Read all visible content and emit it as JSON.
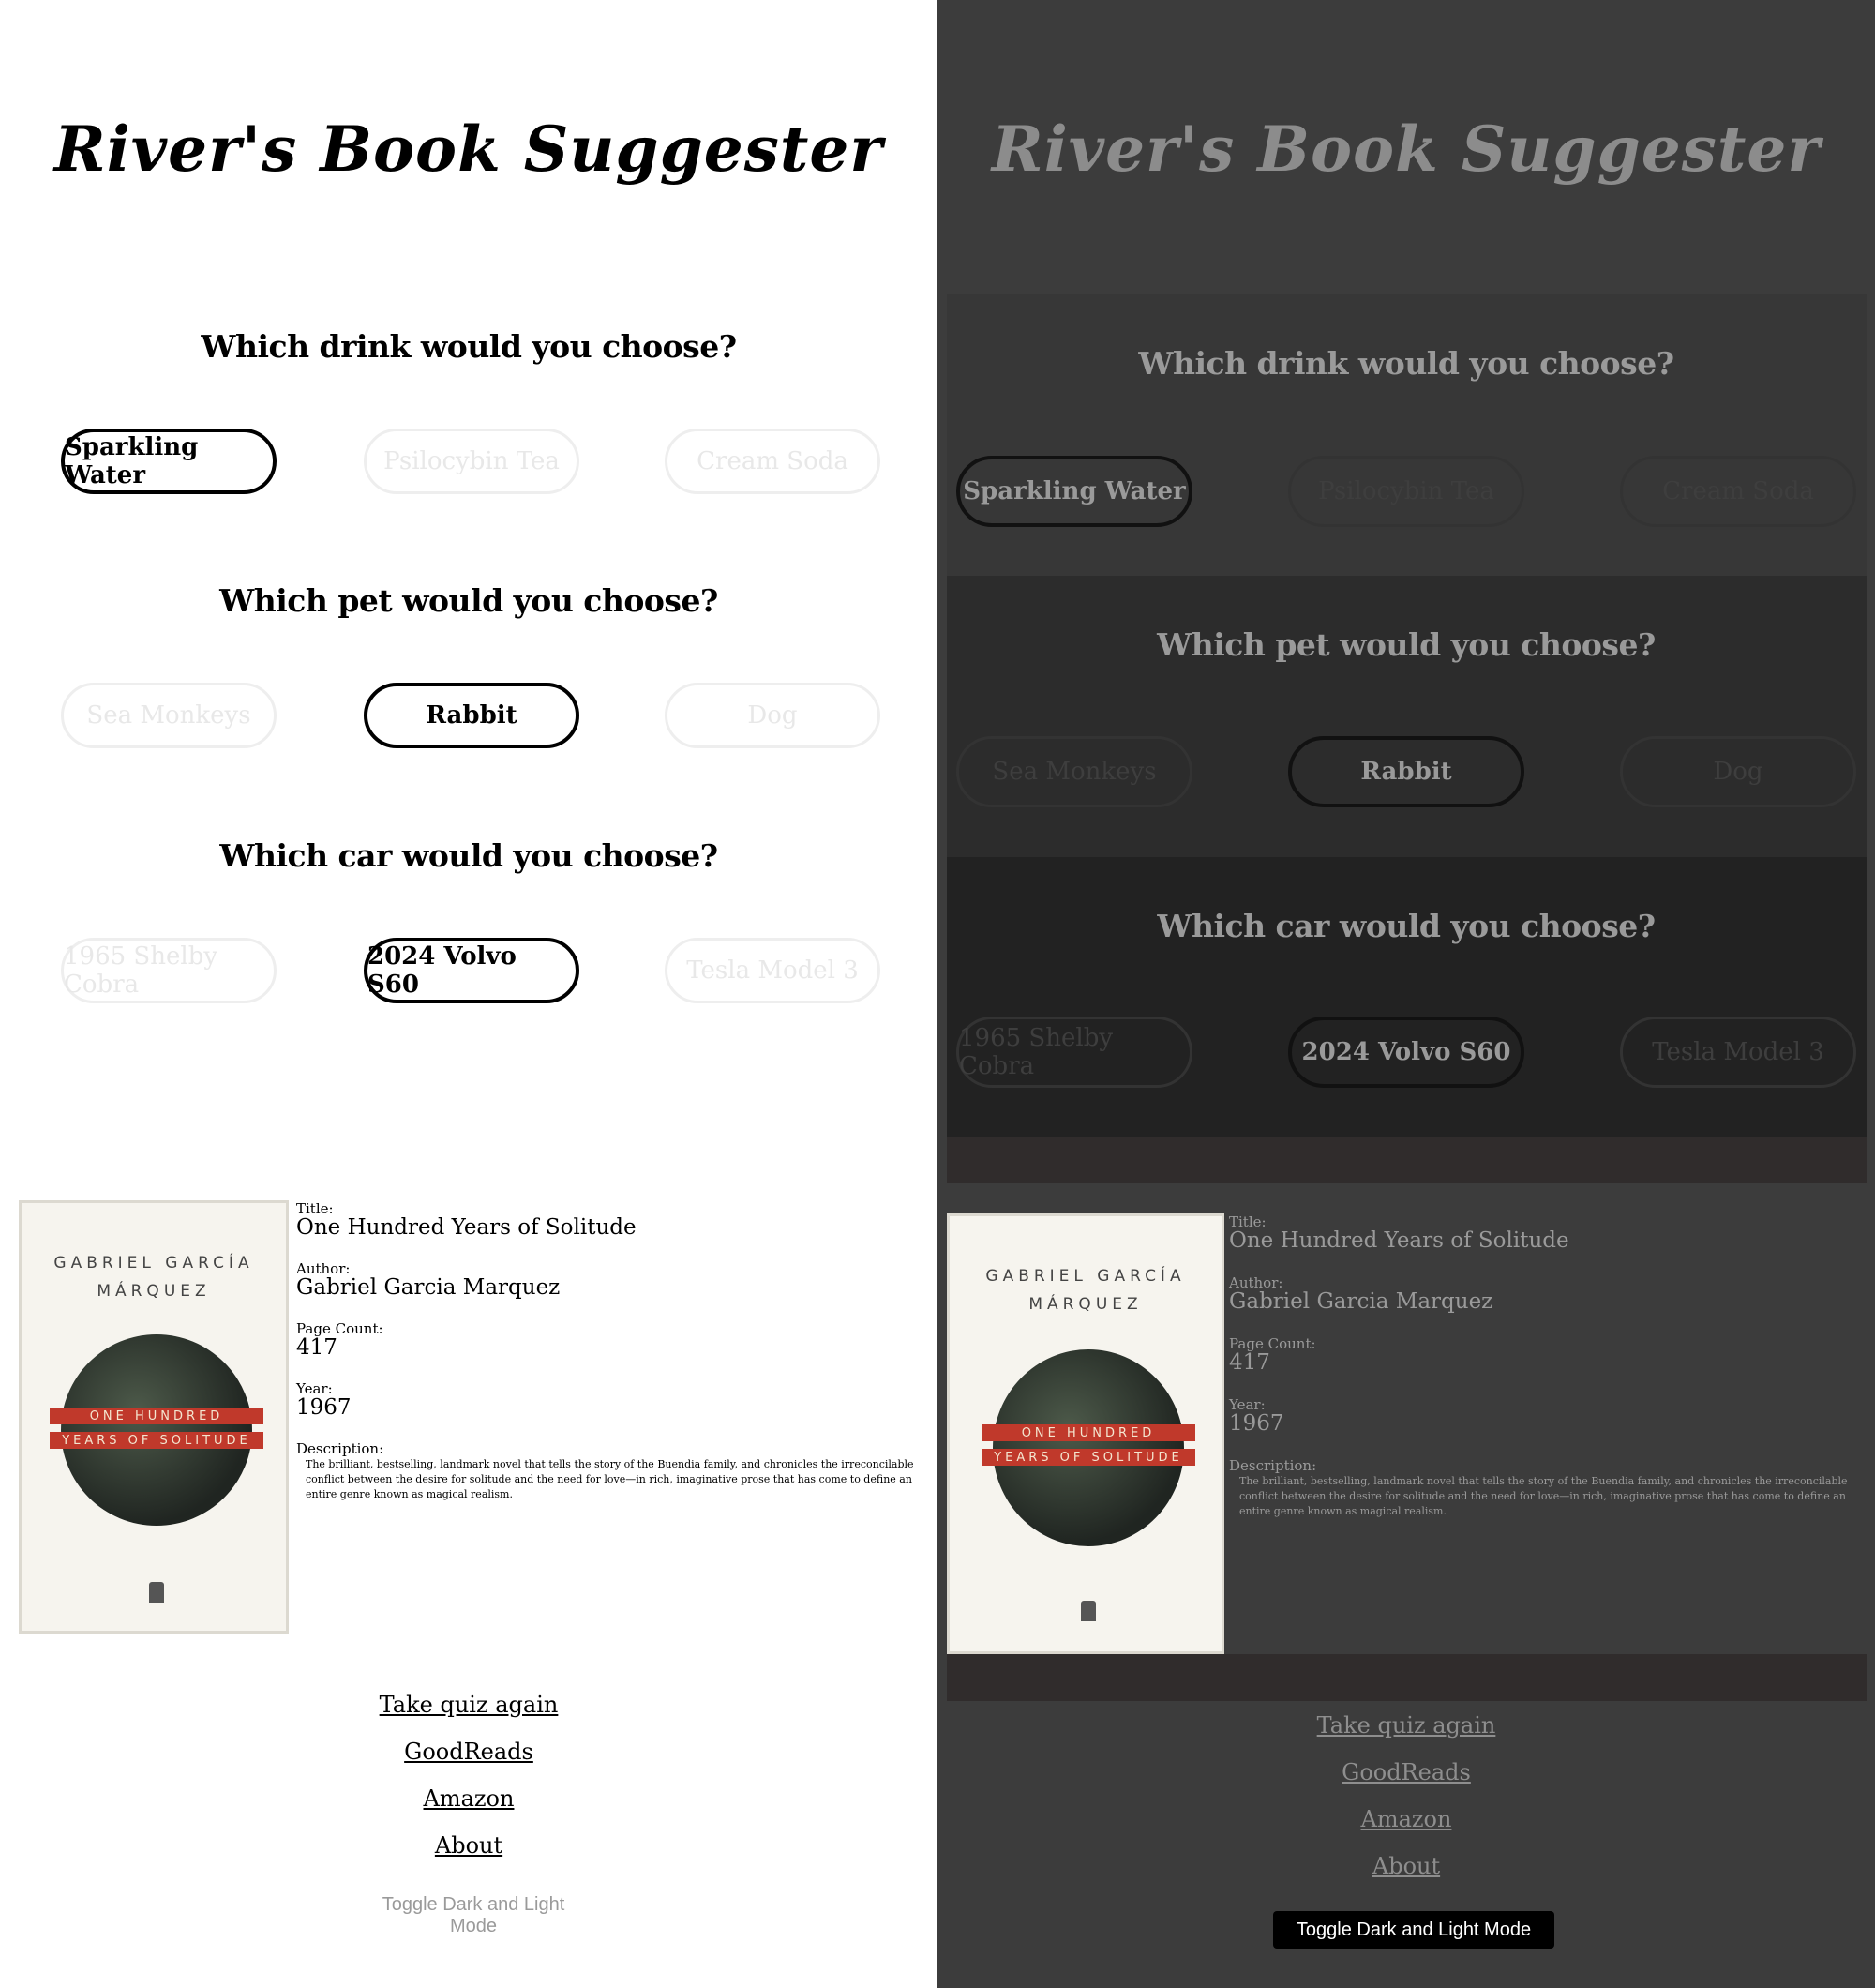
{
  "site": {
    "title": "River's Book Suggester"
  },
  "questions": [
    {
      "prompt": "Which drink would you choose?",
      "options": [
        "Sparkling Water",
        "Psilocybin Tea",
        "Cream Soda"
      ],
      "selected": 0
    },
    {
      "prompt": "Which pet would you choose?",
      "options": [
        "Sea Monkeys",
        "Rabbit",
        "Dog"
      ],
      "selected": 1
    },
    {
      "prompt": "Which car would you choose?",
      "options": [
        "1965 Shelby Cobra",
        "2024 Volvo S60",
        "Tesla Model 3"
      ],
      "selected": 1
    }
  ],
  "result": {
    "labels": {
      "title": "Title:",
      "author": "Author:",
      "pages": "Page Count:",
      "year": "Year:",
      "description": "Description:"
    },
    "title": "One Hundred Years of Solitude",
    "author": "Gabriel Garcia Marquez",
    "pages": "417",
    "year": "1967",
    "description": "The brilliant, bestselling, landmark novel that tells the story of the Buendia family, and chronicles the irreconcilable conflict between the desire for solitude and the need for love—in rich, imaginative prose that has come to define an entire genre known as magical realism.",
    "cover": {
      "author_line1": "GABRIEL GARCÍA",
      "author_line2": "MÁRQUEZ",
      "band1": "ONE HUNDRED",
      "band2": "YEARS OF SOLITUDE"
    }
  },
  "links": {
    "retake": "Take quiz again",
    "goodreads": "GoodReads",
    "amazon": "Amazon",
    "about": "About"
  },
  "toggle": {
    "label": "Toggle Dark and Light Mode"
  },
  "colors": {
    "light_bg": "#ffffff",
    "dark_bg": "#3c3c3c",
    "accent_red": "#c0392b"
  }
}
